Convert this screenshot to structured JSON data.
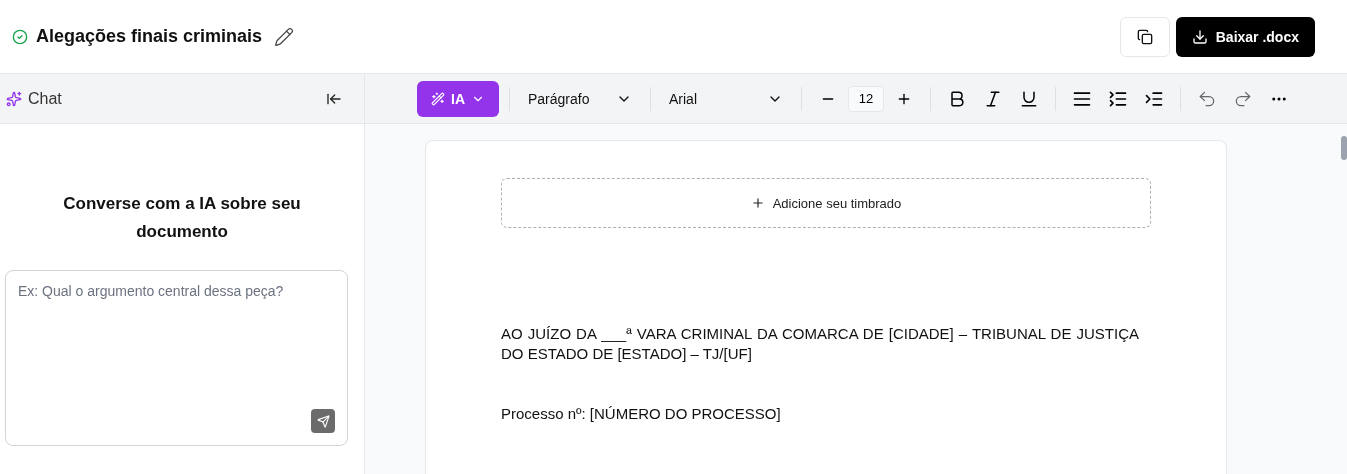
{
  "header": {
    "title": "Alegações finais criminais",
    "download_button": "Baixar .docx"
  },
  "chat": {
    "title": "Chat",
    "heading": "Converse com a IA sobre seu documento",
    "input": {
      "placeholder": "Ex: Qual o argumento central dessa peça?"
    }
  },
  "toolbar": {
    "ai_button": "IA",
    "style_select": "Parágrafo",
    "font_select": "Arial",
    "font_size": "12"
  },
  "document": {
    "letterhead_button": "Adicione seu timbrado",
    "paragraphs": [
      "AO JUÍZO DA ___ª VARA CRIMINAL DA COMARCA DE [CIDADE] – TRIBUNAL DE JUSTIÇA DO ESTADO DE [ESTADO] – TJ/[UF]",
      "Processo nº: [NÚMERO DO PROCESSO]"
    ]
  }
}
